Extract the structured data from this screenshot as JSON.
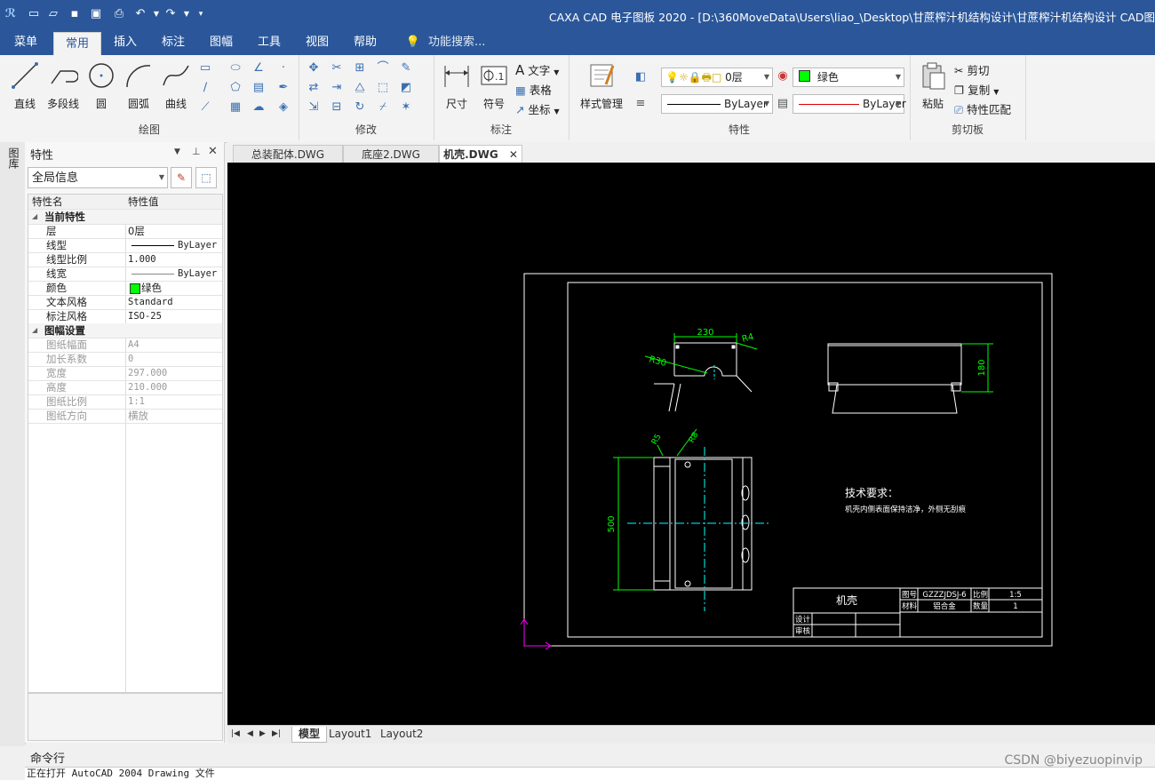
{
  "window": {
    "title": "CAXA CAD 电子图板 2020 - [D:\\360MoveData\\Users\\liao_\\Desktop\\甘蔗榨汁机结构设计\\甘蔗榨汁机结构设计 CAD图"
  },
  "menus": [
    "菜单",
    "常用",
    "插入",
    "标注",
    "图幅",
    "工具",
    "视图",
    "帮助"
  ],
  "active_menu": "常用",
  "search": {
    "placeholder": "功能搜索..."
  },
  "ribbon": {
    "draw": {
      "label": "绘图",
      "line": "直线",
      "polyline": "多段线",
      "circle": "圆",
      "arc": "圆弧",
      "curve": "曲线"
    },
    "modify": {
      "label": "修改"
    },
    "annotate": {
      "label": "标注",
      "dimension": "尺寸",
      "symbol": "符号",
      "text": "文字",
      "table": "表格",
      "coord": "坐标"
    },
    "style": {
      "label": "样式管理"
    },
    "properties": {
      "label": "特性",
      "layer": "0层",
      "color": "绿色",
      "color_hex": "#00ff00",
      "linetype": "ByLayer",
      "lineweight": "ByLayer"
    },
    "clipboard": {
      "label": "剪切板",
      "paste": "粘贴",
      "cut": "剪切",
      "copy": "复制",
      "match": "特性匹配"
    }
  },
  "left_strip": {
    "label": "图库"
  },
  "properties_panel": {
    "title": "特性",
    "selector": "全局信息",
    "col_name": "特性名",
    "col_value": "特性值",
    "sections": [
      {
        "name": "当前特性",
        "rows": [
          {
            "k": "层",
            "v": "0层"
          },
          {
            "k": "线型",
            "v": "ByLayer"
          },
          {
            "k": "线型比例",
            "v": "1.000"
          },
          {
            "k": "线宽",
            "v": "ByLayer"
          },
          {
            "k": "颜色",
            "v": "绿色"
          },
          {
            "k": "文本风格",
            "v": "Standard"
          },
          {
            "k": "标注风格",
            "v": "ISO-25"
          }
        ]
      },
      {
        "name": "图幅设置",
        "rows": [
          {
            "k": "图纸幅面",
            "v": "A4"
          },
          {
            "k": "加长系数",
            "v": "0"
          },
          {
            "k": "宽度",
            "v": "297.000"
          },
          {
            "k": "高度",
            "v": "210.000"
          },
          {
            "k": "图纸比例",
            "v": "1:1"
          },
          {
            "k": "图纸方向",
            "v": "横放"
          }
        ]
      }
    ]
  },
  "doc_tabs": [
    "总装配体.DWG",
    "底座2.DWG",
    "机壳.DWG"
  ],
  "active_doc_tab": "机壳.DWG",
  "drawing": {
    "dims": {
      "top_width": "230",
      "r_top_right": "R4",
      "r_left": "R30",
      "height_side": "180",
      "height_front": "500",
      "r_a": "R5",
      "r_b": "R8"
    },
    "tech_title": "技术要求：",
    "tech_text": "机壳内侧表面保持洁净，外侧无刮痕",
    "title_block": {
      "part_name": "机壳",
      "label_drawing_no": "图号",
      "drawing_no": "GZZZJDSJ-6",
      "label_scale": "比例",
      "scale": "1:5",
      "label_material": "材料",
      "material": "铝合金",
      "label_qty": "数量",
      "qty": "1",
      "label_design": "设计",
      "label_review": "审核"
    }
  },
  "layout_tabs": [
    "模型",
    "Layout1",
    "Layout2"
  ],
  "command": {
    "label": "命令行",
    "output": "正在打开 AutoCAD 2004 Drawing 文件"
  },
  "watermark": "CSDN @biyezuopinvip"
}
